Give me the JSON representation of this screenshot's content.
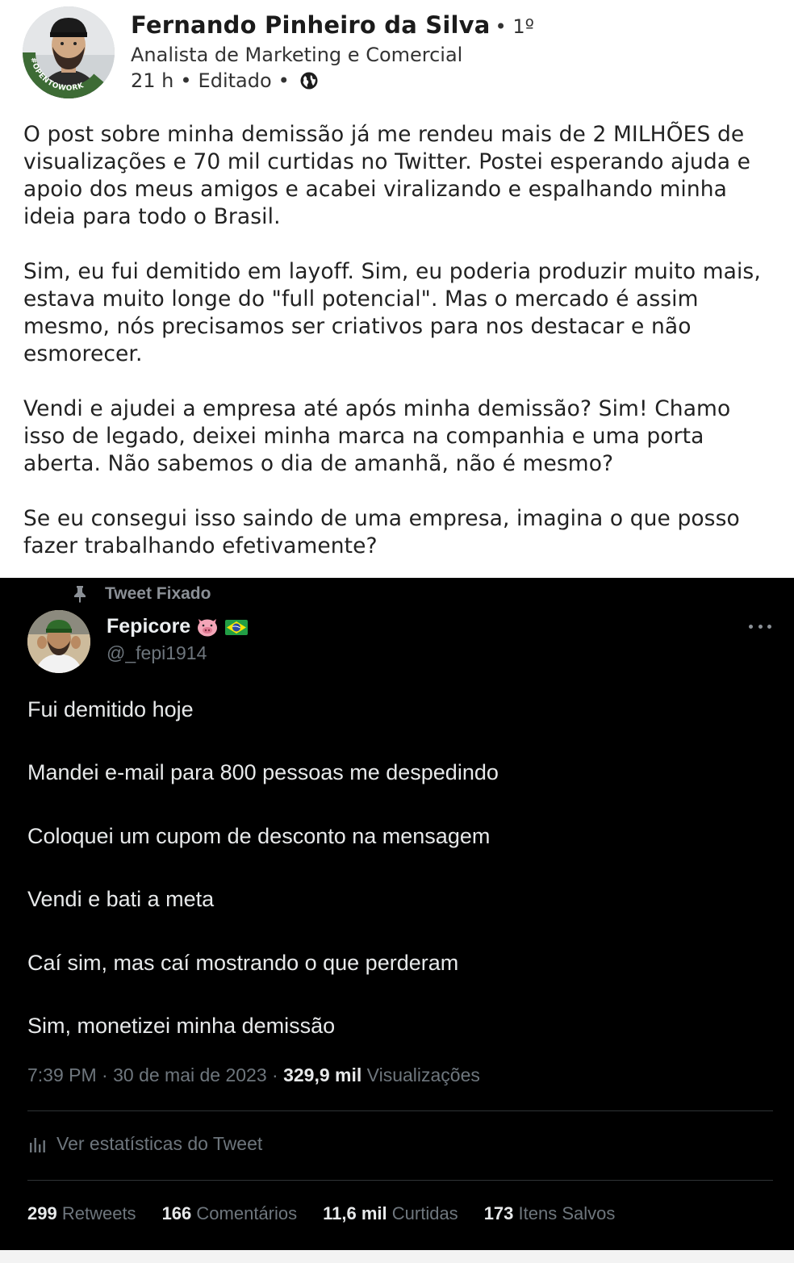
{
  "author": {
    "name": "Fernando Pinheiro da Silva",
    "degree": "• 1º",
    "headline": "Analista de Marketing e Comercial",
    "time": "21 h",
    "edited": "Editado",
    "avatar_badge": "#OPENTOWORK"
  },
  "post": {
    "paragraphs": [
      [
        "O post sobre minha demissão já me rendeu mais de 2 MILHÕES de",
        "visualizações e 70 mil curtidas no Twitter. Postei esperando ajuda e",
        "apoio dos meus amigos e acabei viralizando e espalhando minha",
        "ideia para todo o Brasil."
      ],
      [
        "Sim, eu fui demitido em layoff. Sim, eu poderia produzir muito mais,",
        "estava muito longe do \"full potencial\". Mas o mercado é assim",
        "mesmo, nós precisamos ser criativos para nos destacar e não",
        "esmorecer."
      ],
      [
        "Vendi e ajudei a empresa até após minha demissão? Sim! Chamo",
        "isso de legado, deixei minha marca na companhia e uma porta",
        "aberta. Não sabemos o dia de amanhã, não é mesmo?"
      ],
      [
        "Se eu consegui isso saindo de uma empresa, imagina o que posso",
        "fazer trabalhando efetivamente?"
      ]
    ]
  },
  "tweet": {
    "pinned_label": "Tweet Fixado",
    "name": "Fepicore",
    "handle": "@_fepi1914",
    "lines": [
      "Fui demitido hoje",
      "Mandei e-mail para 800 pessoas me despedindo",
      "Coloquei um cupom de desconto na mensagem",
      "Vendi e bati a meta",
      "Caí sim, mas caí mostrando o que perderam",
      "Sim, monetizei minha demissão"
    ],
    "timestamp": "7:39 PM · 30 de mai de 2023 · ",
    "views_count": "329,9 mil",
    "views_label": "Visualizações",
    "stats_link": "Ver estatísticas do Tweet",
    "counts": [
      {
        "value": "299",
        "label": "Retweets"
      },
      {
        "value": "166",
        "label": "Comentários"
      },
      {
        "value": "11,6 mil",
        "label": "Curtidas"
      },
      {
        "value": "173",
        "label": "Itens Salvos"
      }
    ]
  },
  "colors": {
    "tweet_bg": "#000000",
    "tweet_text": "#e7e9ea",
    "tweet_muted": "#6e767d",
    "opentowork_green": "#3d6b35"
  },
  "icons": [
    "globe-icon",
    "pin-icon",
    "pig-emoji-icon",
    "brazil-flag-icon",
    "more-icon",
    "stats-bars-icon"
  ]
}
